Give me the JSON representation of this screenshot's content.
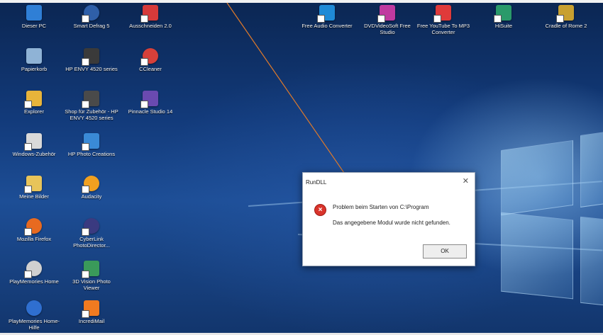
{
  "desktop_icons": [
    {
      "label": "Dieser PC",
      "color": "#2f7fd6",
      "icon": "computer-icon"
    },
    {
      "label": "Smart Defrag 5",
      "color": "#2f5fa8",
      "icon": "defrag-icon"
    },
    {
      "label": "Ausschneiden 2.0",
      "color": "#d63a3a",
      "icon": "scissors-app-icon"
    },
    {
      "label": "Papierkorb",
      "color": "#8fb3d6",
      "icon": "recycle-bin-icon"
    },
    {
      "label": "HP ENVY 4520 series",
      "color": "#3a3a3a",
      "icon": "printer-icon"
    },
    {
      "label": "CCleaner",
      "color": "#d6403a",
      "icon": "ccleaner-icon"
    },
    {
      "label": "Explorer",
      "color": "#e8b43a",
      "icon": "folder-icon"
    },
    {
      "label": "Shop für Zubehör - HP ENVY 4520 series",
      "color": "#4a4a4a",
      "icon": "printer-shop-icon"
    },
    {
      "label": "Pinnacle Studio 14",
      "color": "#6a4ab0",
      "icon": "pinnacle-icon"
    },
    {
      "label": "Windows-Zubehör",
      "color": "#d9d9d9",
      "icon": "windows-accessories-icon"
    },
    {
      "label": "HP Photo Creations",
      "color": "#3a8ad6",
      "icon": "photo-icon"
    },
    {
      "label": "Meine Bilder",
      "color": "#e8c45a",
      "icon": "pictures-folder-icon"
    },
    {
      "label": "Audacity",
      "color": "#f0a020",
      "icon": "audacity-icon"
    },
    {
      "label": "Mozilla Firefox",
      "color": "#e86a20",
      "icon": "firefox-icon"
    },
    {
      "label": "CyberLink PhotoDirector...",
      "color": "#3a3a80",
      "icon": "photodirector-icon"
    },
    {
      "label": "PlayMemories Home",
      "color": "#d0d0d0",
      "icon": "playmemories-icon"
    },
    {
      "label": "3D Vision Photo Viewer",
      "color": "#3a9a5a",
      "icon": "vision-viewer-icon"
    },
    {
      "label": "PlayMemories Home-Hilfe",
      "color": "#2f6fd0",
      "icon": "help-icon"
    },
    {
      "label": "IncrediMail",
      "color": "#f07a20",
      "icon": "incredimail-icon"
    },
    {
      "label": "Free Audio Converter",
      "color": "#1f8ad6",
      "icon": "headphones-icon"
    },
    {
      "label": "DVDVideoSoft Free Studio",
      "color": "#c03aa0",
      "icon": "free-studio-icon"
    },
    {
      "label": "Free YouTube To MP3 Converter",
      "color": "#e03a3a",
      "icon": "youtube-mp3-icon"
    },
    {
      "label": "HiSuite",
      "color": "#2a9a6a",
      "icon": "hisuite-icon"
    },
    {
      "label": "Cradle of Rome 2",
      "color": "#c8a030",
      "icon": "game-icon"
    }
  ],
  "dialog": {
    "title": "RunDLL",
    "close": "✕",
    "error_symbol": "×",
    "message_line1": "Problem beim Starten von C:\\Program",
    "message_line2": "Das angegebene Modul wurde nicht gefunden.",
    "ok_label": "OK"
  },
  "annotation": {
    "color": "#e07a2a"
  }
}
